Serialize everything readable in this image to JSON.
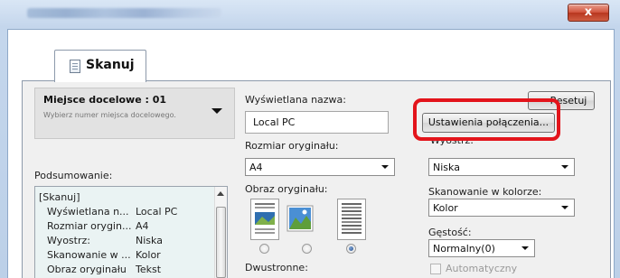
{
  "window": {
    "close_glyph": "x"
  },
  "tab": {
    "label": "Skanuj",
    "icon": "scan-document-icon"
  },
  "destination": {
    "title": "Miejsce docelowe : 01",
    "subtitle": "Wybierz numer miejsca docelowego."
  },
  "summary": {
    "label": "Podsumowanie:",
    "rows": [
      {
        "key": "[Skanuj]",
        "value": ""
      },
      {
        "key": "Wyświetlana n...",
        "value": "Local PC"
      },
      {
        "key": "Rozmiar orygin...",
        "value": "A4"
      },
      {
        "key": "Wyostrz:",
        "value": "Niska"
      },
      {
        "key": "Skanowanie w ...",
        "value": "Kolor"
      },
      {
        "key": "Obraz oryginału",
        "value": "Tekst"
      }
    ]
  },
  "fields": {
    "display_name_label": "Wyświetlana nazwa:",
    "display_name_value": "Local PC",
    "original_size_label": "Rozmiar oryginału:",
    "original_size_value": "A4",
    "original_image_label": "Obraz oryginału:",
    "duplex_label": "Dwustronne:",
    "original_image_selected_index": 2
  },
  "right": {
    "reset_label": "Resetuj",
    "connection_settings_label": "Ustawienia połączenia...",
    "sharpen_label": "Wyostrz:",
    "sharpen_value": "Niska",
    "color_scan_label": "Skanowanie w kolorze:",
    "color_scan_value": "Kolor",
    "density_label": "Gęstość:",
    "density_value": "Normalny(0)",
    "auto_label": "Automatyczny",
    "auto_checked": false
  },
  "colors": {
    "highlight": "#e3141b",
    "summary_bg": "#eaf3f3",
    "close_button": "#c9452e"
  }
}
